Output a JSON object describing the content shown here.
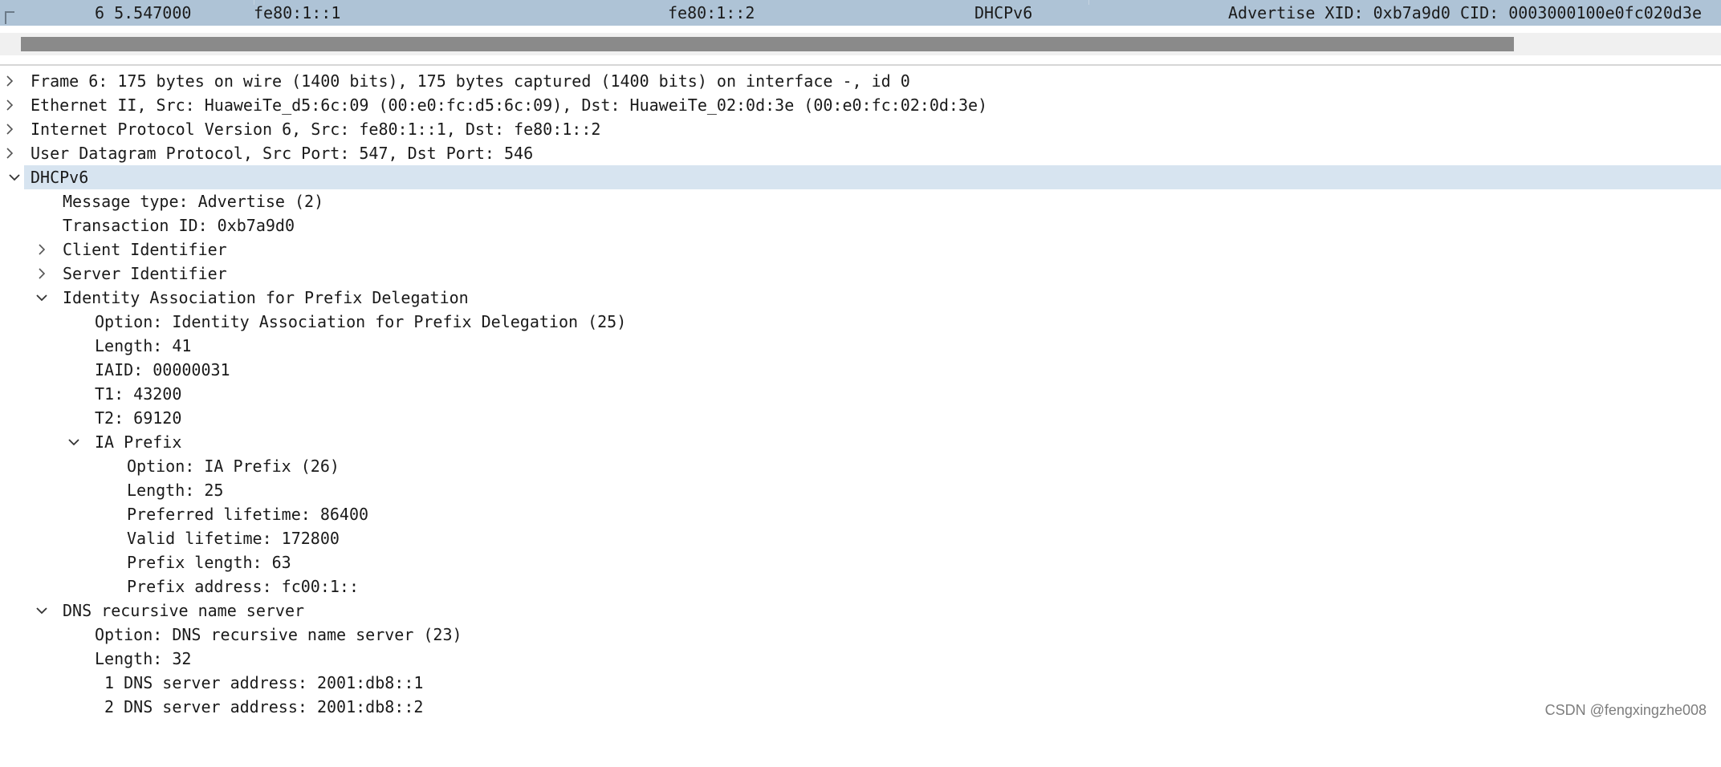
{
  "packet_list": {
    "selected_row": {
      "no_time": "6 5.547000",
      "source": "fe80:1::1",
      "destination": "fe80:1::2",
      "protocol": "DHCPv6",
      "info": "Advertise XID: 0xb7a9d0 CID: 0003000100e0fc020d3e"
    }
  },
  "details": {
    "frame": "Frame 6: 175 bytes on wire (1400 bits), 175 bytes captured (1400 bits) on interface -, id 0",
    "ethernet": "Ethernet II, Src: HuaweiTe_d5:6c:09 (00:e0:fc:d5:6c:09), Dst: HuaweiTe_02:0d:3e (00:e0:fc:02:0d:3e)",
    "ipv6": "Internet Protocol Version 6, Src: fe80:1::1, Dst: fe80:1::2",
    "udp": "User Datagram Protocol, Src Port: 547, Dst Port: 546",
    "dhcpv6": {
      "label": "DHCPv6",
      "message_type": "Message type: Advertise (2)",
      "transaction_id": "Transaction ID: 0xb7a9d0",
      "client_identifier": "Client Identifier",
      "server_identifier": "Server Identifier",
      "ia_pd": {
        "label": "Identity Association for Prefix Delegation",
        "option": "Option: Identity Association for Prefix Delegation (25)",
        "length": "Length: 41",
        "iaid": "IAID: 00000031",
        "t1": "T1: 43200",
        "t2": "T2: 69120",
        "ia_prefix": {
          "label": "IA Prefix",
          "option": "Option: IA Prefix (26)",
          "length": "Length: 25",
          "preferred_lifetime": "Preferred lifetime: 86400",
          "valid_lifetime": "Valid lifetime: 172800",
          "prefix_length": "Prefix length: 63",
          "prefix_address": "Prefix address: fc00:1::"
        }
      },
      "dns": {
        "label": "DNS recursive name server",
        "option": "Option: DNS recursive name server (23)",
        "length": "Length: 32",
        "server1": " 1 DNS server address: 2001:db8::1",
        "server2": " 2 DNS server address: 2001:db8::2"
      }
    }
  },
  "watermark": "CSDN @fengxingzhe008",
  "icons": {
    "collapsed": "chevron-right-icon",
    "expanded": "chevron-down-icon"
  },
  "colors": {
    "selected_packet_row": "#aec3d6",
    "selected_tree_row": "#d7e4f0",
    "scrollbar_thumb": "#8a8a8a"
  }
}
